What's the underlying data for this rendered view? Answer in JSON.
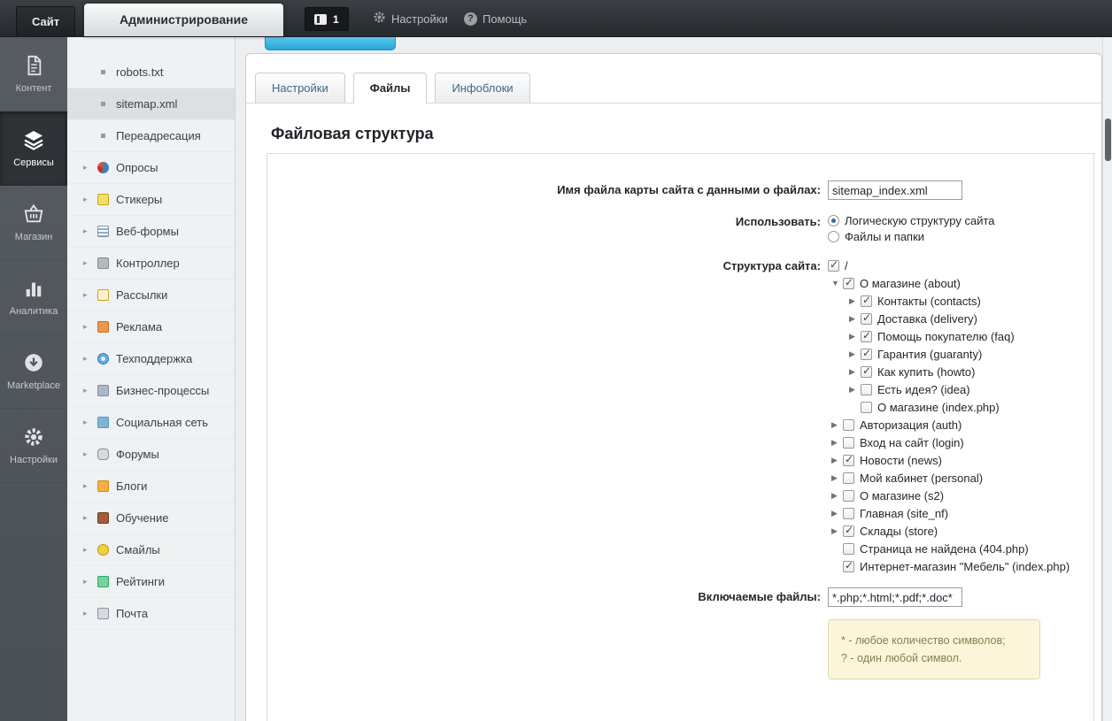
{
  "topbar": {
    "site_tab": "Сайт",
    "admin_tab": "Администрирование",
    "notification_count": "1",
    "settings_label": "Настройки",
    "help_label": "Помощь"
  },
  "iconbar": {
    "items": [
      {
        "id": "content",
        "label": "Контент",
        "icon": "document-icon",
        "active": false
      },
      {
        "id": "services",
        "label": "Сервисы",
        "icon": "layers-icon",
        "active": true
      },
      {
        "id": "shop",
        "label": "Магазин",
        "icon": "basket-icon",
        "active": false
      },
      {
        "id": "analytics",
        "label": "Аналитика",
        "icon": "chart-icon",
        "active": false
      },
      {
        "id": "marketplace",
        "label": "Marketplace",
        "icon": "download-icon",
        "active": false
      },
      {
        "id": "settings",
        "label": "Настройки",
        "icon": "gear-icon",
        "active": false
      }
    ]
  },
  "sidebar": {
    "items": [
      {
        "id": "robots",
        "label": "robots.txt",
        "icon": "bullet-icon",
        "expandable": false,
        "selected": false
      },
      {
        "id": "sitemap",
        "label": "sitemap.xml",
        "icon": "bullet-icon",
        "expandable": false,
        "selected": true
      },
      {
        "id": "redirect",
        "label": "Переадресация",
        "icon": "bullet-icon",
        "expandable": false,
        "selected": false
      },
      {
        "id": "polls",
        "label": "Опросы",
        "icon": "poll-icon",
        "expandable": true,
        "selected": false
      },
      {
        "id": "stickers",
        "label": "Стикеры",
        "icon": "sticker-icon",
        "expandable": true,
        "selected": false
      },
      {
        "id": "webforms",
        "label": "Веб-формы",
        "icon": "webform-icon",
        "expandable": true,
        "selected": false
      },
      {
        "id": "controller",
        "label": "Контроллер",
        "icon": "controller-icon",
        "expandable": true,
        "selected": false
      },
      {
        "id": "mailing",
        "label": "Рассылки",
        "icon": "mailing-icon",
        "expandable": true,
        "selected": false
      },
      {
        "id": "ads",
        "label": "Реклама",
        "icon": "ads-icon",
        "expandable": true,
        "selected": false
      },
      {
        "id": "support",
        "label": "Техподдержка",
        "icon": "support-icon",
        "expandable": true,
        "selected": false
      },
      {
        "id": "bizproc",
        "label": "Бизнес-процессы",
        "icon": "bizproc-icon",
        "expandable": true,
        "selected": false
      },
      {
        "id": "social",
        "label": "Социальная сеть",
        "icon": "social-icon",
        "expandable": true,
        "selected": false
      },
      {
        "id": "forums",
        "label": "Форумы",
        "icon": "forum-icon",
        "expandable": true,
        "selected": false
      },
      {
        "id": "blogs",
        "label": "Блоги",
        "icon": "blog-icon",
        "expandable": true,
        "selected": false
      },
      {
        "id": "training",
        "label": "Обучение",
        "icon": "training-icon",
        "expandable": true,
        "selected": false
      },
      {
        "id": "smiles",
        "label": "Смайлы",
        "icon": "smile-icon",
        "expandable": true,
        "selected": false
      },
      {
        "id": "ratings",
        "label": "Рейтинги",
        "icon": "rating-icon",
        "expandable": true,
        "selected": false
      },
      {
        "id": "mail",
        "label": "Почта",
        "icon": "mail-icon",
        "expandable": true,
        "selected": false
      }
    ]
  },
  "main": {
    "tabs": [
      {
        "label": "Настройки",
        "active": false
      },
      {
        "label": "Файлы",
        "active": true
      },
      {
        "label": "Инфоблоки",
        "active": false
      }
    ],
    "title": "Файловая структура",
    "form": {
      "filename_label": "Имя файла карты сайта с данными о файлах:",
      "filename_value": "sitemap_index.xml",
      "use_label": "Использовать:",
      "use_options": [
        {
          "label": "Логическую структуру сайта",
          "selected": true
        },
        {
          "label": "Файлы и папки",
          "selected": false
        }
      ],
      "structure_label": "Структура сайта:",
      "tree": [
        {
          "label": "/",
          "level": 0,
          "arrow": "none",
          "checked": true
        },
        {
          "label": "О магазине (about)",
          "level": 1,
          "arrow": "down",
          "checked": true
        },
        {
          "label": "Контакты (contacts)",
          "level": 2,
          "arrow": "right",
          "checked": true
        },
        {
          "label": "Доставка (delivery)",
          "level": 2,
          "arrow": "right",
          "checked": true
        },
        {
          "label": "Помощь покупателю (faq)",
          "level": 2,
          "arrow": "right",
          "checked": true
        },
        {
          "label": "Гарантия (guaranty)",
          "level": 2,
          "arrow": "right",
          "checked": true
        },
        {
          "label": "Как купить (howto)",
          "level": 2,
          "arrow": "right",
          "checked": true
        },
        {
          "label": "Есть идея? (idea)",
          "level": 2,
          "arrow": "right",
          "checked": false
        },
        {
          "label": "О магазине (index.php)",
          "level": 2,
          "arrow": "none",
          "checked": false
        },
        {
          "label": "Авторизация (auth)",
          "level": 1,
          "arrow": "right",
          "checked": false
        },
        {
          "label": "Вход на сайт (login)",
          "level": 1,
          "arrow": "right",
          "checked": false
        },
        {
          "label": "Новости (news)",
          "level": 1,
          "arrow": "right",
          "checked": true
        },
        {
          "label": "Мой кабинет (personal)",
          "level": 1,
          "arrow": "right",
          "checked": false
        },
        {
          "label": "О магазине (s2)",
          "level": 1,
          "arrow": "right",
          "checked": false
        },
        {
          "label": "Главная (site_nf)",
          "level": 1,
          "arrow": "right",
          "checked": false
        },
        {
          "label": "Склады (store)",
          "level": 1,
          "arrow": "right",
          "checked": true
        },
        {
          "label": "Страница не найдена (404.php)",
          "level": 1,
          "arrow": "none",
          "checked": false
        },
        {
          "label": "Интернет-магазин \"Мебель\" (index.php)",
          "level": 1,
          "arrow": "none",
          "checked": true
        }
      ],
      "include_label": "Включаемые файлы:",
      "include_value": "*.php;*.html;*.pdf;*.doc*",
      "note_lines": [
        "* - любое количество символов;",
        "? - один любой символ."
      ]
    }
  },
  "colors": {
    "accent_blue": "#35a9de",
    "topbar_dark": "#2b2f33",
    "note_bg": "#fbf6da",
    "note_border": "#e2d8ab",
    "note_text": "#8a7d51"
  }
}
